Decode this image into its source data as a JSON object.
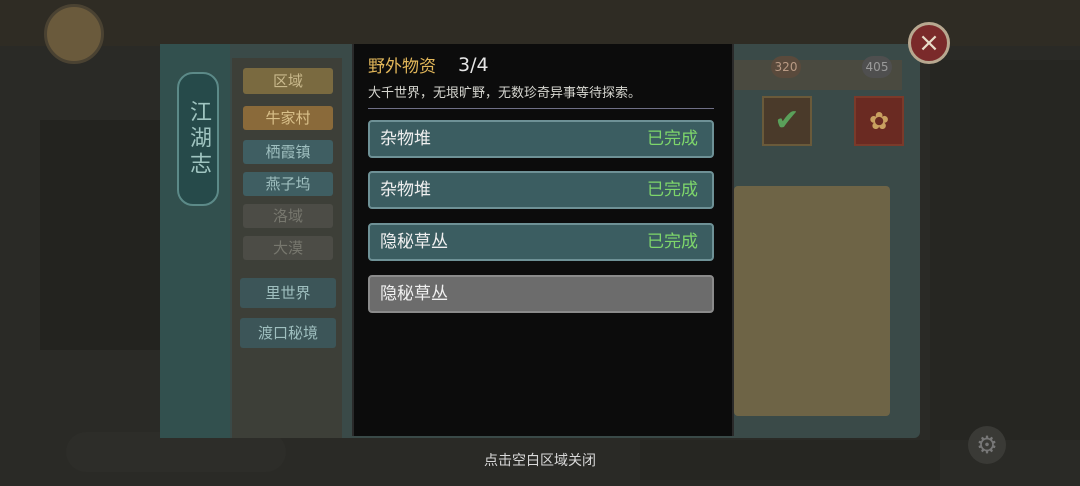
{
  "background": {
    "journal_title": "江湖志",
    "region_label": "区域",
    "regions": [
      "牛家村",
      "栖霞镇",
      "燕子坞",
      "洛域",
      "大漠"
    ],
    "inner_world": "里世界",
    "ferry_secret": "渡口秘境",
    "badge_left": "320",
    "badge_right": "405",
    "close_icon": "×"
  },
  "modal": {
    "title": "野外物资",
    "count": "3/4",
    "description": "大千世界，无垠旷野，无数珍奇异事等待探索。",
    "items": [
      {
        "name": "杂物堆",
        "status": "已完成",
        "completed": true
      },
      {
        "name": "杂物堆",
        "status": "已完成",
        "completed": true
      },
      {
        "name": "隐秘草丛",
        "status": "已完成",
        "completed": true
      },
      {
        "name": "隐秘草丛",
        "status": "",
        "completed": false
      }
    ]
  },
  "hint": "点击空白区域关闭",
  "colors": {
    "title_gold": "#e2b75a",
    "done_bg": "#3b5d61",
    "pending_bg": "#6c6c6c",
    "status_green": "#7ed66b"
  }
}
